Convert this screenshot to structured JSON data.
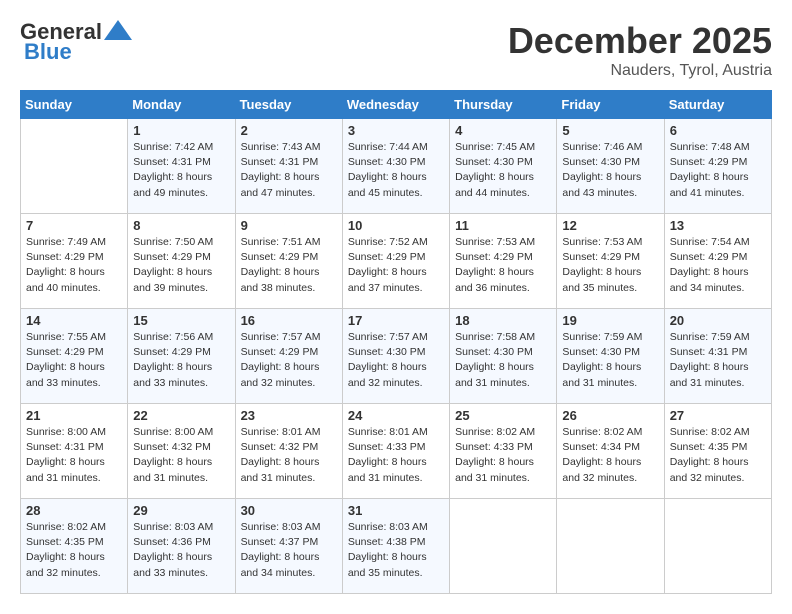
{
  "logo": {
    "line1": "General",
    "line2": "Blue"
  },
  "title": "December 2025",
  "location": "Nauders, Tyrol, Austria",
  "days_of_week": [
    "Sunday",
    "Monday",
    "Tuesday",
    "Wednesday",
    "Thursday",
    "Friday",
    "Saturday"
  ],
  "weeks": [
    [
      {
        "day": null,
        "info": null
      },
      {
        "day": "1",
        "info": "Sunrise: 7:42 AM\nSunset: 4:31 PM\nDaylight: 8 hours\nand 49 minutes."
      },
      {
        "day": "2",
        "info": "Sunrise: 7:43 AM\nSunset: 4:31 PM\nDaylight: 8 hours\nand 47 minutes."
      },
      {
        "day": "3",
        "info": "Sunrise: 7:44 AM\nSunset: 4:30 PM\nDaylight: 8 hours\nand 45 minutes."
      },
      {
        "day": "4",
        "info": "Sunrise: 7:45 AM\nSunset: 4:30 PM\nDaylight: 8 hours\nand 44 minutes."
      },
      {
        "day": "5",
        "info": "Sunrise: 7:46 AM\nSunset: 4:30 PM\nDaylight: 8 hours\nand 43 minutes."
      },
      {
        "day": "6",
        "info": "Sunrise: 7:48 AM\nSunset: 4:29 PM\nDaylight: 8 hours\nand 41 minutes."
      }
    ],
    [
      {
        "day": "7",
        "info": "Sunrise: 7:49 AM\nSunset: 4:29 PM\nDaylight: 8 hours\nand 40 minutes."
      },
      {
        "day": "8",
        "info": "Sunrise: 7:50 AM\nSunset: 4:29 PM\nDaylight: 8 hours\nand 39 minutes."
      },
      {
        "day": "9",
        "info": "Sunrise: 7:51 AM\nSunset: 4:29 PM\nDaylight: 8 hours\nand 38 minutes."
      },
      {
        "day": "10",
        "info": "Sunrise: 7:52 AM\nSunset: 4:29 PM\nDaylight: 8 hours\nand 37 minutes."
      },
      {
        "day": "11",
        "info": "Sunrise: 7:53 AM\nSunset: 4:29 PM\nDaylight: 8 hours\nand 36 minutes."
      },
      {
        "day": "12",
        "info": "Sunrise: 7:53 AM\nSunset: 4:29 PM\nDaylight: 8 hours\nand 35 minutes."
      },
      {
        "day": "13",
        "info": "Sunrise: 7:54 AM\nSunset: 4:29 PM\nDaylight: 8 hours\nand 34 minutes."
      }
    ],
    [
      {
        "day": "14",
        "info": "Sunrise: 7:55 AM\nSunset: 4:29 PM\nDaylight: 8 hours\nand 33 minutes."
      },
      {
        "day": "15",
        "info": "Sunrise: 7:56 AM\nSunset: 4:29 PM\nDaylight: 8 hours\nand 33 minutes."
      },
      {
        "day": "16",
        "info": "Sunrise: 7:57 AM\nSunset: 4:29 PM\nDaylight: 8 hours\nand 32 minutes."
      },
      {
        "day": "17",
        "info": "Sunrise: 7:57 AM\nSunset: 4:30 PM\nDaylight: 8 hours\nand 32 minutes."
      },
      {
        "day": "18",
        "info": "Sunrise: 7:58 AM\nSunset: 4:30 PM\nDaylight: 8 hours\nand 31 minutes."
      },
      {
        "day": "19",
        "info": "Sunrise: 7:59 AM\nSunset: 4:30 PM\nDaylight: 8 hours\nand 31 minutes."
      },
      {
        "day": "20",
        "info": "Sunrise: 7:59 AM\nSunset: 4:31 PM\nDaylight: 8 hours\nand 31 minutes."
      }
    ],
    [
      {
        "day": "21",
        "info": "Sunrise: 8:00 AM\nSunset: 4:31 PM\nDaylight: 8 hours\nand 31 minutes."
      },
      {
        "day": "22",
        "info": "Sunrise: 8:00 AM\nSunset: 4:32 PM\nDaylight: 8 hours\nand 31 minutes."
      },
      {
        "day": "23",
        "info": "Sunrise: 8:01 AM\nSunset: 4:32 PM\nDaylight: 8 hours\nand 31 minutes."
      },
      {
        "day": "24",
        "info": "Sunrise: 8:01 AM\nSunset: 4:33 PM\nDaylight: 8 hours\nand 31 minutes."
      },
      {
        "day": "25",
        "info": "Sunrise: 8:02 AM\nSunset: 4:33 PM\nDaylight: 8 hours\nand 31 minutes."
      },
      {
        "day": "26",
        "info": "Sunrise: 8:02 AM\nSunset: 4:34 PM\nDaylight: 8 hours\nand 32 minutes."
      },
      {
        "day": "27",
        "info": "Sunrise: 8:02 AM\nSunset: 4:35 PM\nDaylight: 8 hours\nand 32 minutes."
      }
    ],
    [
      {
        "day": "28",
        "info": "Sunrise: 8:02 AM\nSunset: 4:35 PM\nDaylight: 8 hours\nand 32 minutes."
      },
      {
        "day": "29",
        "info": "Sunrise: 8:03 AM\nSunset: 4:36 PM\nDaylight: 8 hours\nand 33 minutes."
      },
      {
        "day": "30",
        "info": "Sunrise: 8:03 AM\nSunset: 4:37 PM\nDaylight: 8 hours\nand 34 minutes."
      },
      {
        "day": "31",
        "info": "Sunrise: 8:03 AM\nSunset: 4:38 PM\nDaylight: 8 hours\nand 35 minutes."
      },
      {
        "day": null,
        "info": null
      },
      {
        "day": null,
        "info": null
      },
      {
        "day": null,
        "info": null
      }
    ]
  ]
}
